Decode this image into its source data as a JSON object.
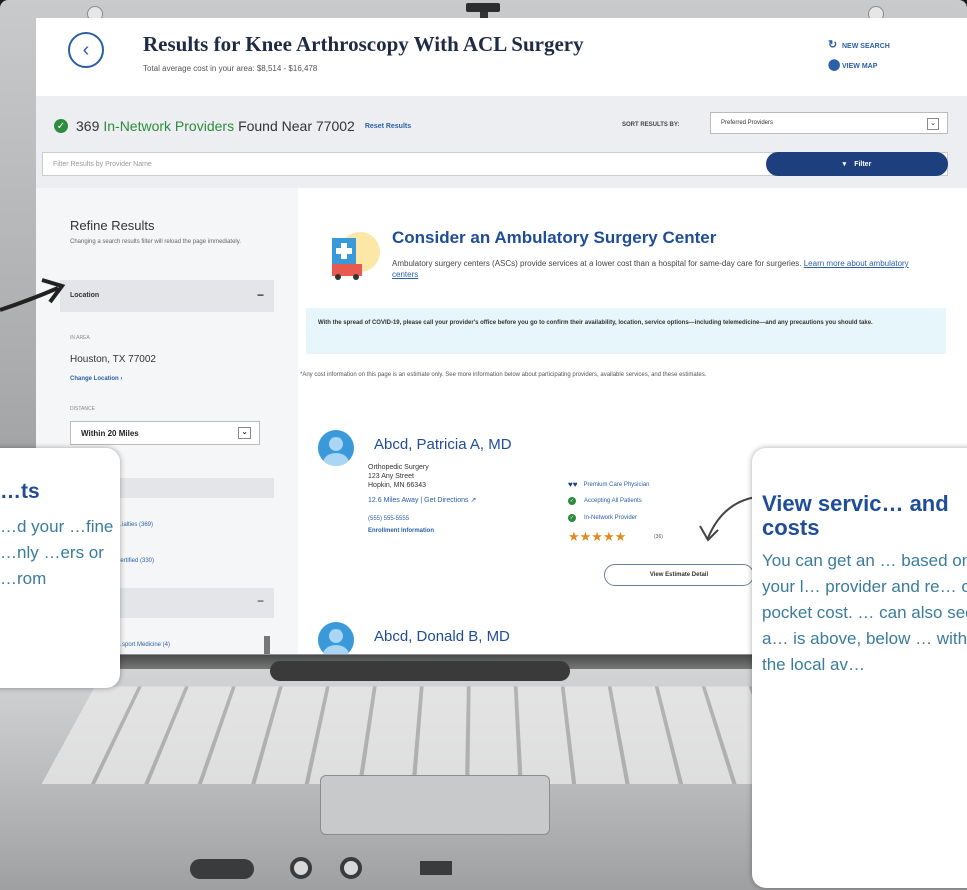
{
  "header": {
    "title": "Results for Knee Arthroscopy With ACL Surgery",
    "avg_cost": "Total average cost in your area: $8,514 - $16,478",
    "new_search": "NEW SEARCH",
    "view_map": "VIEW MAP"
  },
  "results": {
    "count": "369",
    "in_network": "In-Network Providers",
    "found_near": "Found Near 77002",
    "reset": "Reset Results",
    "sort_label": "SORT RESULTS BY:",
    "sort_value": "Preferred Providers",
    "filter_placeholder": "Filter Results by Provider Name",
    "filter_button": "Filter"
  },
  "sidebar": {
    "title": "Refine Results",
    "note": "Changing a search results filter will reload the page immediately.",
    "location_label": "Location",
    "city_label": "IN AREA",
    "city": "Houston, TX 77002",
    "change_location": "Change Location",
    "distance_label": "DISTANCE",
    "distance_value": "Within 20 Miles",
    "facet_1": "…ialties (369)",
    "facet_2": "Certified (330)",
    "facet_3": "…sport Medicine (4)"
  },
  "asc": {
    "title": "Consider an Ambulatory Surgery Center",
    "text": "Ambulatory surgery centers (ASCs) provide services at a lower cost than a hospital for same-day care for surgeries.",
    "link": "Learn more about ambulatory centers"
  },
  "covid_notice": "With the spread of COVID-19, please call your provider's office before you go to confirm their availability, location, service options—including telemedicine—and any precautions you should take.",
  "disclaimer": "*Any cost information on this page is an estimate only. See more information below about participating providers, available services, and these estimates.",
  "providers": [
    {
      "name": "Abcd, Patricia A, MD",
      "specialty": "Orthopedic Surgery",
      "address1": "123 Any Street",
      "address2": "Hopkin, MN 66343",
      "distance": "12.6 Miles Away",
      "directions": "Get Directions",
      "phone": "(555) 555-5555",
      "enrollment": "Enrollment Information",
      "badge_premium": "Premium Care Physician",
      "badge_accepting": "Accepting All Patients",
      "badge_network": "In-Network Provider",
      "rating": 4.5,
      "stars": "★★★★★",
      "reviews": "(36)",
      "estimate_button": "View Estimate Detail"
    },
    {
      "name": "Abcd, Donald B, MD"
    }
  ],
  "callout_left": {
    "title": "…ts",
    "text": "…d your …fine …nly …ers or …rom"
  },
  "callout_right": {
    "title": "View servic… and costs",
    "text": "You can get an … based on your l… provider and re… of-pocket cost. … can also see if a… is above, below … with the local av…"
  },
  "colors": {
    "brand_blue": "#1f4d97",
    "link_blue": "#2b5fa6",
    "success_green": "#2e8b3e",
    "star_orange": "#e08a1e",
    "callout_text": "#3a7c9c"
  }
}
